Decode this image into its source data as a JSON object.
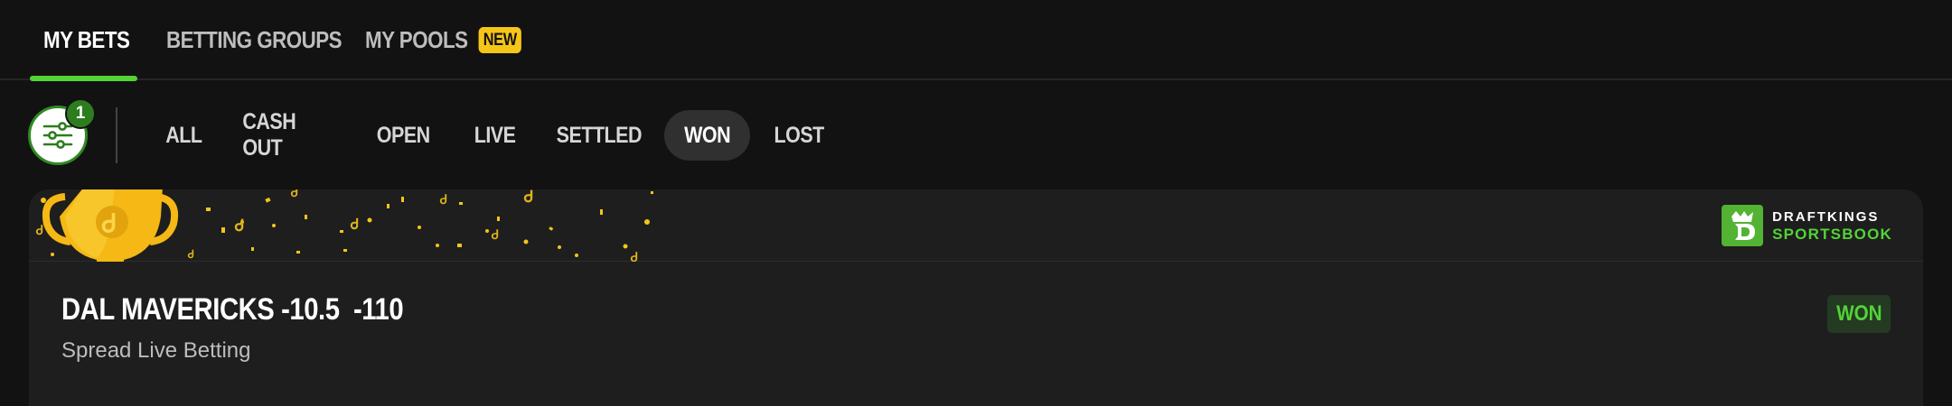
{
  "nav": {
    "tabs": [
      {
        "label": "MY BETS",
        "active": true
      },
      {
        "label": "BETTING GROUPS",
        "active": false
      },
      {
        "label": "MY POOLS",
        "active": false,
        "badge": "NEW"
      }
    ]
  },
  "filters": {
    "count": "1",
    "chips": [
      {
        "label": "ALL"
      },
      {
        "label": "CASH OUT"
      },
      {
        "label": "OPEN"
      },
      {
        "label": "LIVE"
      },
      {
        "label": "SETTLED"
      },
      {
        "label": "WON",
        "active": true
      },
      {
        "label": "LOST"
      }
    ]
  },
  "bet": {
    "title": "DAL MAVERICKS -10.5  -110",
    "subtitle": "Spread Live Betting",
    "status": "WON"
  },
  "brand": {
    "line1": "DRAFTKINGS",
    "line2": "SPORTSBOOK",
    "accent": "#53d337",
    "badge_color": "#f5c518"
  }
}
